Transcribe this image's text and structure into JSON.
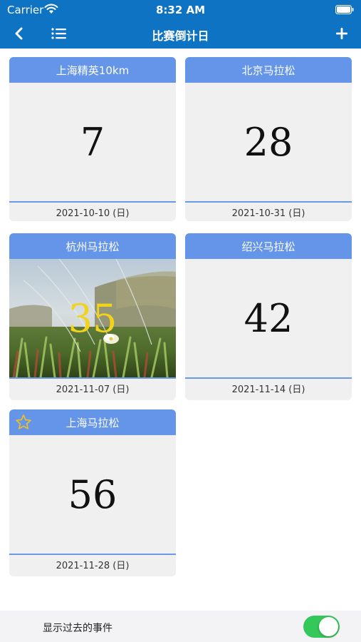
{
  "status_bar": {
    "carrier": "Carrier",
    "time": "8:32 AM"
  },
  "nav": {
    "title": "比赛倒计日",
    "back_icon": "chevron-left-icon",
    "list_icon": "list-icon",
    "add_icon": "plus-icon"
  },
  "events": [
    {
      "name": "上海精英10km",
      "days": "7",
      "date": "2021-10-10 (日)",
      "background": "plain",
      "starred": false
    },
    {
      "name": "北京马拉松",
      "days": "28",
      "date": "2021-10-31 (日)",
      "background": "plain",
      "starred": false
    },
    {
      "name": "杭州马拉松",
      "days": "35",
      "date": "2021-11-07 (日)",
      "background": "photo",
      "starred": false
    },
    {
      "name": "绍兴马拉松",
      "days": "42",
      "date": "2021-11-14 (日)",
      "background": "plain",
      "starred": false
    },
    {
      "name": "上海马拉松",
      "days": "56",
      "date": "2021-11-28 (日)",
      "background": "plain",
      "starred": true
    }
  ],
  "footer": {
    "show_past_label": "显示过去的事件",
    "show_past_enabled": true
  },
  "colors": {
    "nav_bar": "#0f73c4",
    "card_header": "#6495e8",
    "card_body": "#f0f0f0",
    "toggle_on": "#34c759",
    "photo_number": "#f2d21b",
    "star": "#f2c21b"
  }
}
